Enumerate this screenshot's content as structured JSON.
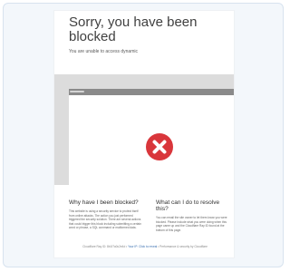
{
  "page": {
    "title": "Sorry, you have been blocked",
    "subtitle": "You are unable to access dynamic"
  },
  "browser": {
    "tab_label": ""
  },
  "icons": {
    "blocked": "x-circle-icon",
    "accent": "#d9363b"
  },
  "sections": {
    "why": {
      "heading": "Why have I been blocked?",
      "body": "This website is using a security service to protect itself from online attacks. The action you just performed triggered the security solution. There are several actions that could trigger this block including submitting a certain word or phrase, a SQL command or malformed data."
    },
    "what": {
      "heading": "What can I do to resolve this?",
      "body": "You can email the site owner to let them know you were blocked. Please include what you were doing when this page came up and the Cloudflare Ray ID found at the bottom of this page."
    }
  },
  "footer": {
    "ray_label": "Cloudflare Ray ID: 8b1f7a0c2e4d",
    "separator": " • ",
    "ip_label": "Your IP: Click to reveal",
    "separator2": " • ",
    "perf_label": "Performance & security by Cloudflare"
  }
}
